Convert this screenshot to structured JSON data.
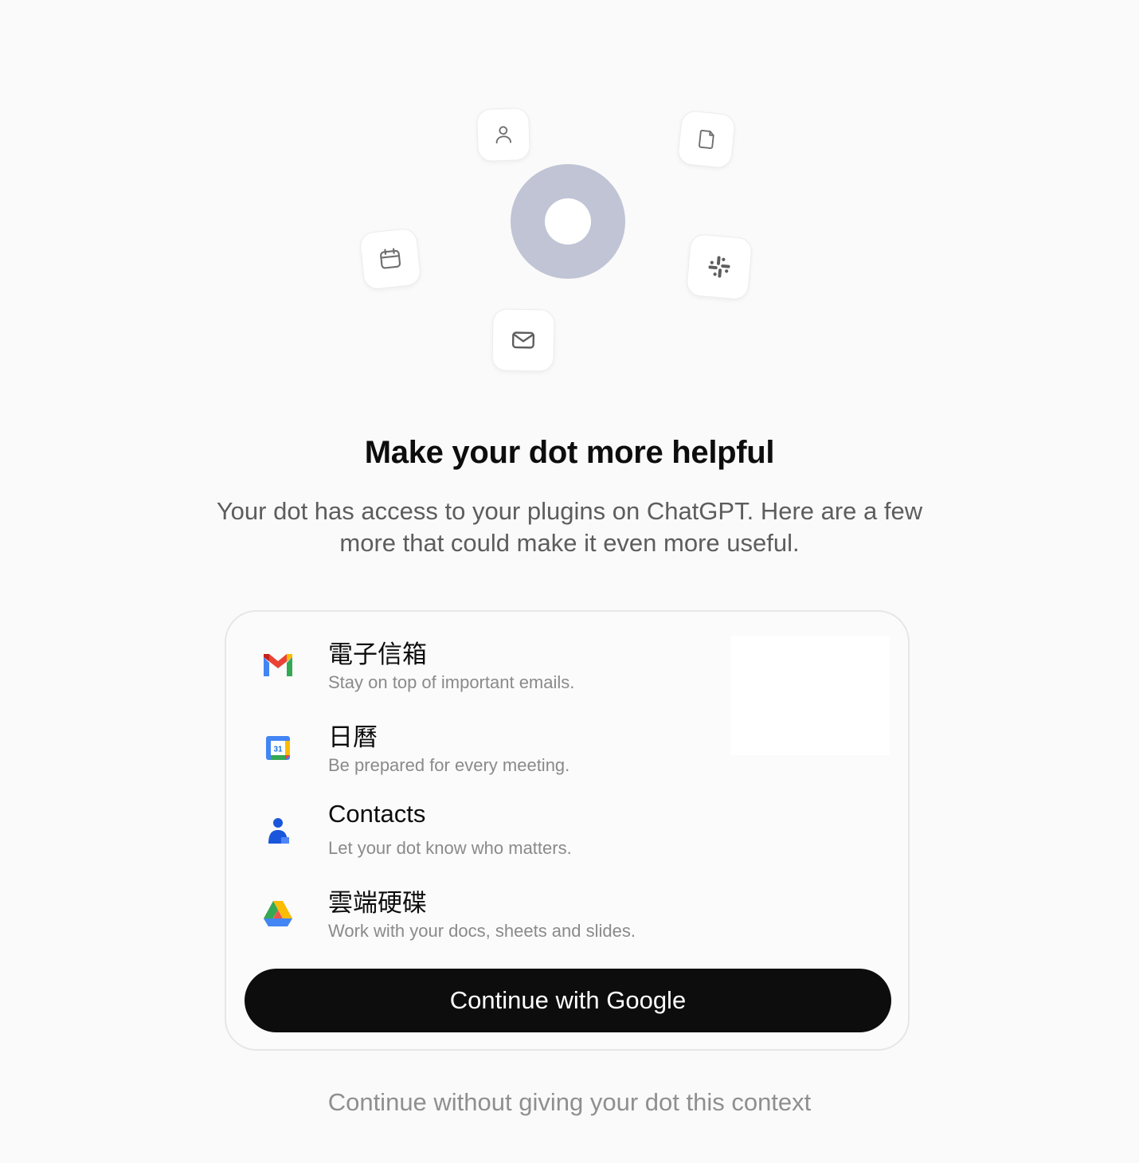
{
  "hero": {
    "icons": [
      "person-icon",
      "document-icon",
      "calendar-icon",
      "slack-icon",
      "mail-icon"
    ],
    "ring_color": "#c0c4d4"
  },
  "header": {
    "title": "Make your dot more helpful",
    "subtitle": "Your dot has access to your plugins on ChatGPT. Here are a few more that could make it even more useful."
  },
  "integrations": [
    {
      "icon": "gmail-icon",
      "title": "電子信箱",
      "description": "Stay on top of important emails."
    },
    {
      "icon": "google-calendar-icon",
      "title": "日曆",
      "description": "Be prepared for every meeting.",
      "badge": "31"
    },
    {
      "icon": "google-contacts-icon",
      "title": "Contacts",
      "description": "Let your dot know who matters."
    },
    {
      "icon": "google-drive-icon",
      "title": "雲端硬碟",
      "description": "Work with your docs, sheets and slides."
    }
  ],
  "actions": {
    "continue_label": "Continue with Google",
    "skip_label": "Continue without giving your dot this context"
  },
  "colors": {
    "background": "#fafafa",
    "button": "#0d0d0d",
    "muted_text": "#8a8a8a"
  }
}
